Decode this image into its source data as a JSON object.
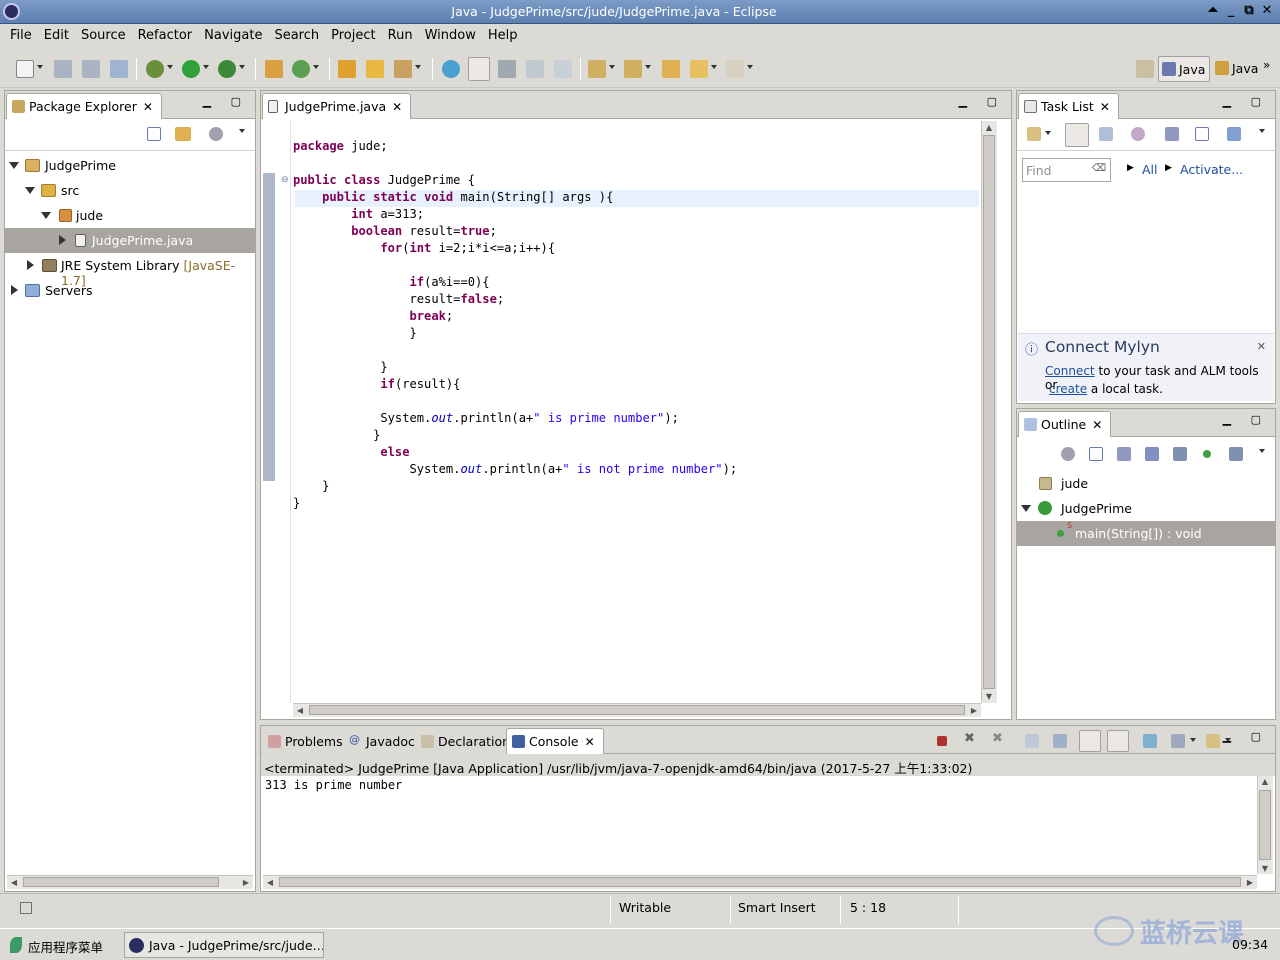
{
  "window": {
    "title": "Java - JudgePrime/src/jude/JudgePrime.java - Eclipse"
  },
  "menu": [
    "File",
    "Edit",
    "Source",
    "Refactor",
    "Navigate",
    "Search",
    "Project",
    "Run",
    "Window",
    "Help"
  ],
  "perspectives": [
    "Java",
    "Java"
  ],
  "package_explorer": {
    "tab": "Package Explorer",
    "items": {
      "project": "JudgePrime",
      "src": "src",
      "pkg": "jude",
      "file": "JudgePrime.java",
      "jre": "JRE System Library",
      "jre_version": "[JavaSE-1.7]",
      "servers": "Servers"
    }
  },
  "editor": {
    "tab": "JudgePrime.java",
    "code": [
      "package jude;",
      "",
      "public class JudgePrime {",
      "    public static void main(String[] args ){",
      "        int a=313;",
      "        boolean result=true;",
      "            for(int i=2;i*i<=a;i++){",
      "",
      "                if(a%i==0){",
      "                result=false;",
      "                break;",
      "                }",
      "",
      "            }",
      "            if(result){",
      "",
      "            System.out.println(a+\" is prime number\");",
      "           }",
      "            else",
      "                System.out.println(a+\" is not prime number\");",
      "    }",
      "}"
    ]
  },
  "task_list": {
    "tab": "Task List",
    "find_placeholder": "Find",
    "all": "All",
    "activate": "Activate...",
    "mylyn_title": "Connect Mylyn",
    "mylyn_connect": "Connect",
    "mylyn_text1": " to your task and ALM tools or",
    "mylyn_create": "create",
    "mylyn_text2": " a local task."
  },
  "outline": {
    "tab": "Outline",
    "pkg": "jude",
    "cls": "JudgePrime",
    "method": "main(String[]) : void"
  },
  "console": {
    "tabs": [
      "Problems",
      "Javadoc",
      "Declaration",
      "Console"
    ],
    "header": "<terminated> JudgePrime [Java Application] /usr/lib/jvm/java-7-openjdk-amd64/bin/java (2017-5-27 上午1:33:02)",
    "output": "313 is prime number"
  },
  "status": {
    "writable": "Writable",
    "insert": "Smart Insert",
    "position": "5 : 18"
  },
  "taskbar": {
    "menu": "应用程序菜单",
    "window": "Java - JudgePrime/src/jude…",
    "clock": "09:34",
    "watermark": "蓝桥云课"
  }
}
